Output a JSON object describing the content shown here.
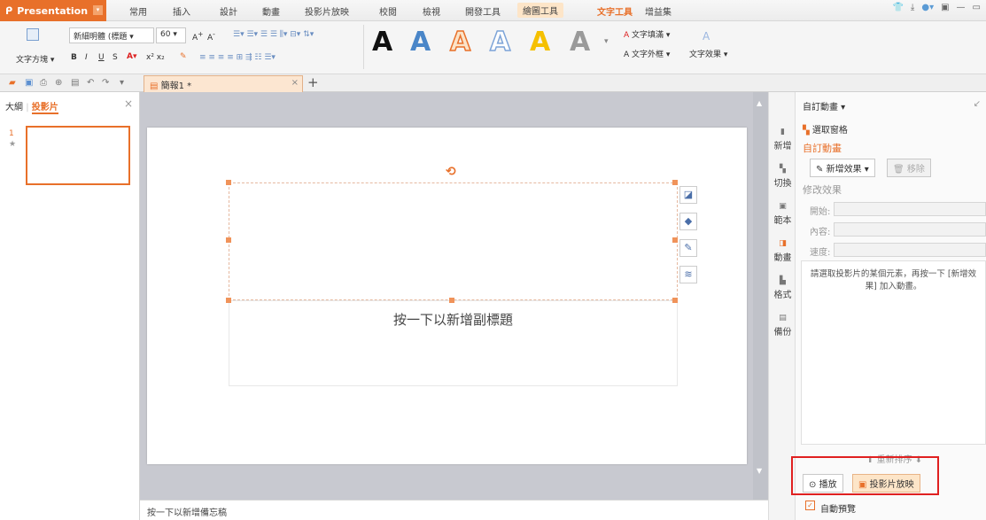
{
  "app": {
    "name": "Presentation"
  },
  "menu": [
    "常用",
    "插入",
    "設計",
    "動畫",
    "投影片放映",
    "校閱",
    "檢視",
    "開發工具",
    "繪圖工具",
    "文字工具",
    "增益集"
  ],
  "ribbon": {
    "text_direction": "文字方塊",
    "font_name": "新細明體 (標題",
    "font_size": "60",
    "big_letters": [
      "A",
      "A",
      "A",
      "A",
      "A",
      "A"
    ],
    "text_fill": "文字填滿",
    "text_outline": "文字外框",
    "text_effect": "文字效果"
  },
  "tabs": {
    "doc": "簡報1 *"
  },
  "left_pane": {
    "tab_outline": "大綱",
    "tab_slides": "投影片",
    "slide_number": "1",
    "star": "★"
  },
  "slide": {
    "subtitle_placeholder": "按一下以新增副標題"
  },
  "notes": {
    "placeholder": "按一下以新增備忘稿"
  },
  "rail": [
    "新增",
    "切換",
    "範本",
    "動畫",
    "格式",
    "備份"
  ],
  "panel": {
    "title": "自訂動畫",
    "select_pane": "選取窗格",
    "section_title": "自訂動畫",
    "add_effect": "新增效果",
    "remove": "移除",
    "modify": "修改效果",
    "start": "開始:",
    "content": "內容:",
    "speed": "速度:",
    "description": "請選取投影片的某個元素，再按一下 [新增效果] 加入動畫。",
    "reorder": "重新排序",
    "play": "播放",
    "slideshow": "投影片放映",
    "autopreview": "自動預覽"
  }
}
